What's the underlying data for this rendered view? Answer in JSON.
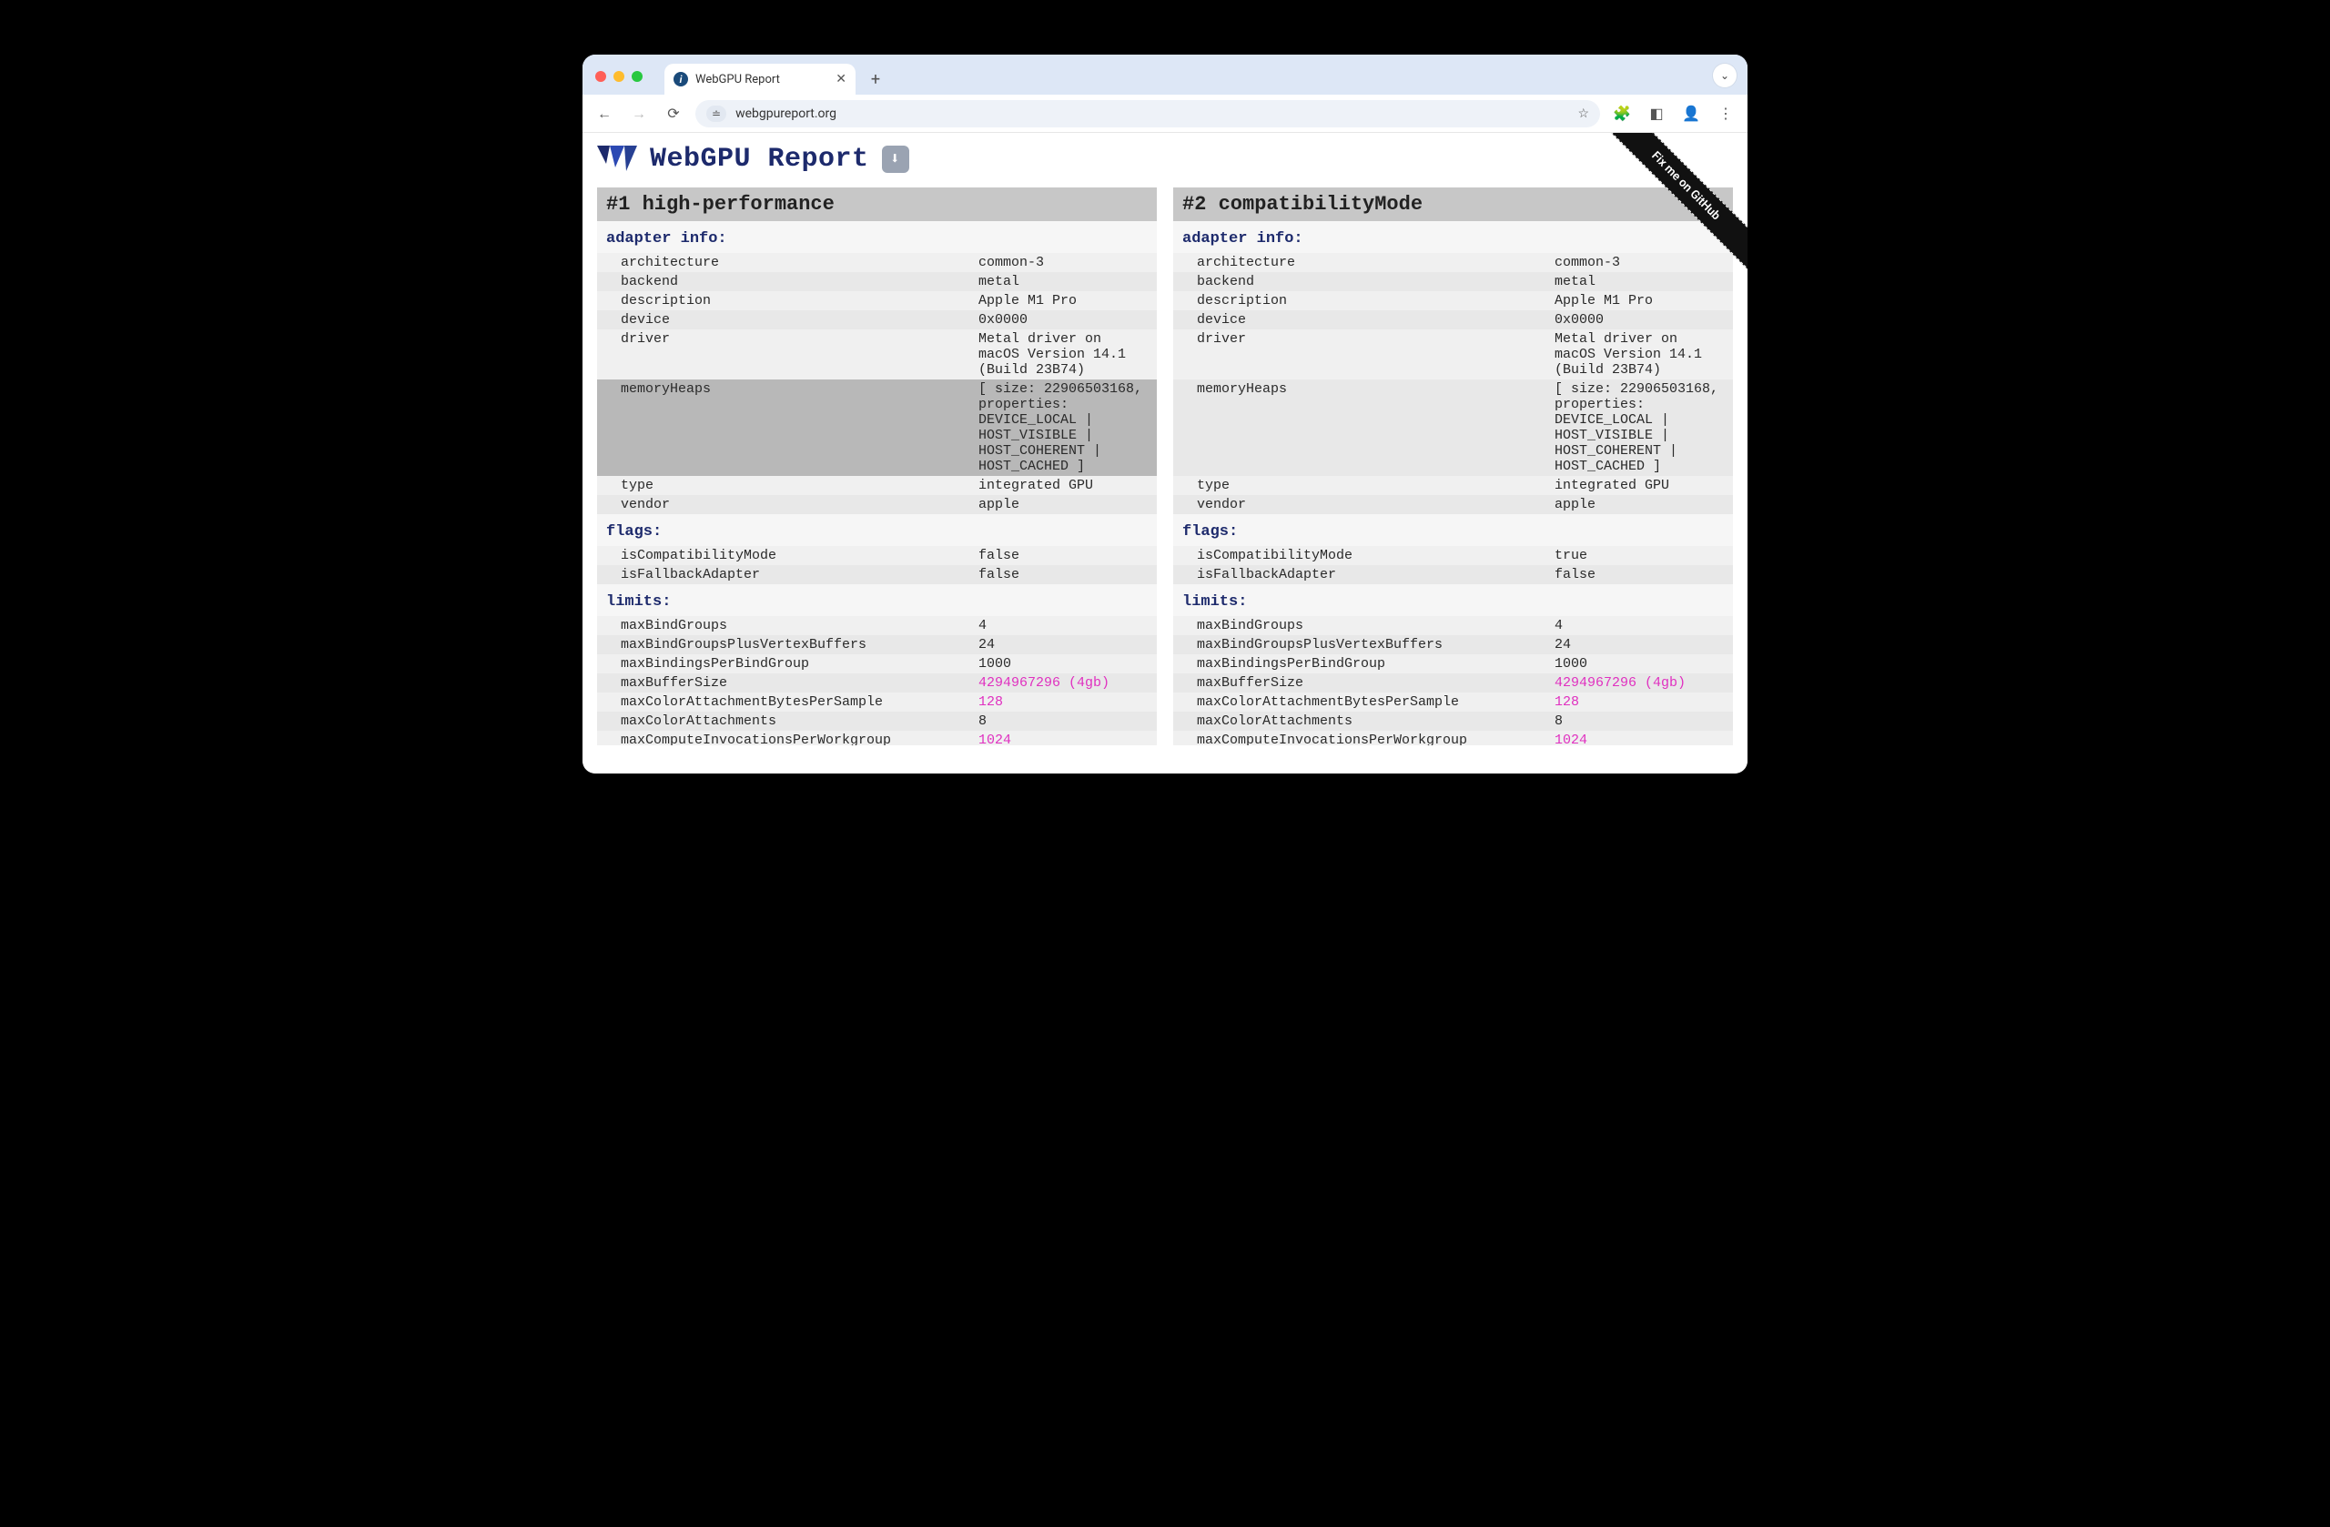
{
  "browser": {
    "tab_title": "WebGPU Report",
    "url": "webgpureport.org",
    "tabs_toggle_glyph": "⌄",
    "close_glyph": "✕",
    "newtab_glyph": "+"
  },
  "ribbon": {
    "text": "Fix me on GitHub"
  },
  "page": {
    "title": "WebGPU Report",
    "download_glyph": "⬇"
  },
  "panels": [
    {
      "header": "#1 high-performance",
      "sections": [
        {
          "title": "adapter info:",
          "rows": [
            {
              "k": "architecture",
              "v": "common-3"
            },
            {
              "k": "backend",
              "v": "metal"
            },
            {
              "k": "description",
              "v": "Apple M1 Pro"
            },
            {
              "k": "device",
              "v": "0x0000"
            },
            {
              "k": "driver",
              "v": "Metal driver on macOS Version 14.1 (Build 23B74)"
            },
            {
              "k": "memoryHeaps",
              "v": "[ size: 22906503168, properties: DEVICE_LOCAL | HOST_VISIBLE | HOST_COHERENT | HOST_CACHED ]",
              "hl": true
            },
            {
              "k": "type",
              "v": "integrated GPU"
            },
            {
              "k": "vendor",
              "v": "apple"
            }
          ]
        },
        {
          "title": "flags:",
          "rows": [
            {
              "k": "isCompatibilityMode",
              "v": "false"
            },
            {
              "k": "isFallbackAdapter",
              "v": "false"
            }
          ]
        },
        {
          "title": "limits:",
          "rows": [
            {
              "k": "maxBindGroups",
              "v": "4"
            },
            {
              "k": "maxBindGroupsPlusVertexBuffers",
              "v": "24"
            },
            {
              "k": "maxBindingsPerBindGroup",
              "v": "1000"
            },
            {
              "k": "maxBufferSize",
              "v": "4294967296 (4gb)",
              "pink": true
            },
            {
              "k": "maxColorAttachmentBytesPerSample",
              "v": "128",
              "pink": true
            },
            {
              "k": "maxColorAttachments",
              "v": "8"
            },
            {
              "k": "maxComputeInvocationsPerWorkgroup",
              "v": "1024",
              "pink": true,
              "truncated": true
            }
          ]
        }
      ]
    },
    {
      "header": "#2 compatibilityMode",
      "sections": [
        {
          "title": "adapter info:",
          "rows": [
            {
              "k": "architecture",
              "v": "common-3"
            },
            {
              "k": "backend",
              "v": "metal"
            },
            {
              "k": "description",
              "v": "Apple M1 Pro"
            },
            {
              "k": "device",
              "v": "0x0000"
            },
            {
              "k": "driver",
              "v": "Metal driver on macOS Version 14.1 (Build 23B74)"
            },
            {
              "k": "memoryHeaps",
              "v": "[ size: 22906503168, properties: DEVICE_LOCAL | HOST_VISIBLE | HOST_COHERENT | HOST_CACHED ]"
            },
            {
              "k": "type",
              "v": "integrated GPU"
            },
            {
              "k": "vendor",
              "v": "apple"
            }
          ]
        },
        {
          "title": "flags:",
          "rows": [
            {
              "k": "isCompatibilityMode",
              "v": "true"
            },
            {
              "k": "isFallbackAdapter",
              "v": "false"
            }
          ]
        },
        {
          "title": "limits:",
          "rows": [
            {
              "k": "maxBindGroups",
              "v": "4"
            },
            {
              "k": "maxBindGroupsPlusVertexBuffers",
              "v": "24"
            },
            {
              "k": "maxBindingsPerBindGroup",
              "v": "1000"
            },
            {
              "k": "maxBufferSize",
              "v": "4294967296 (4gb)",
              "pink": true
            },
            {
              "k": "maxColorAttachmentBytesPerSample",
              "v": "128",
              "pink": true
            },
            {
              "k": "maxColorAttachments",
              "v": "8"
            },
            {
              "k": "maxComputeInvocationsPerWorkgroup",
              "v": "1024",
              "pink": true,
              "truncated": true
            }
          ]
        }
      ]
    }
  ],
  "icons": {
    "back": "←",
    "fwd": "→",
    "reload": "⟳",
    "star": "☆",
    "ext": "🧩",
    "side": "◧",
    "profile": "👤",
    "kebab": "⋮",
    "tune": "≐"
  },
  "colors": {
    "accent": "#1d2a6c",
    "pink": "#e030c0"
  }
}
